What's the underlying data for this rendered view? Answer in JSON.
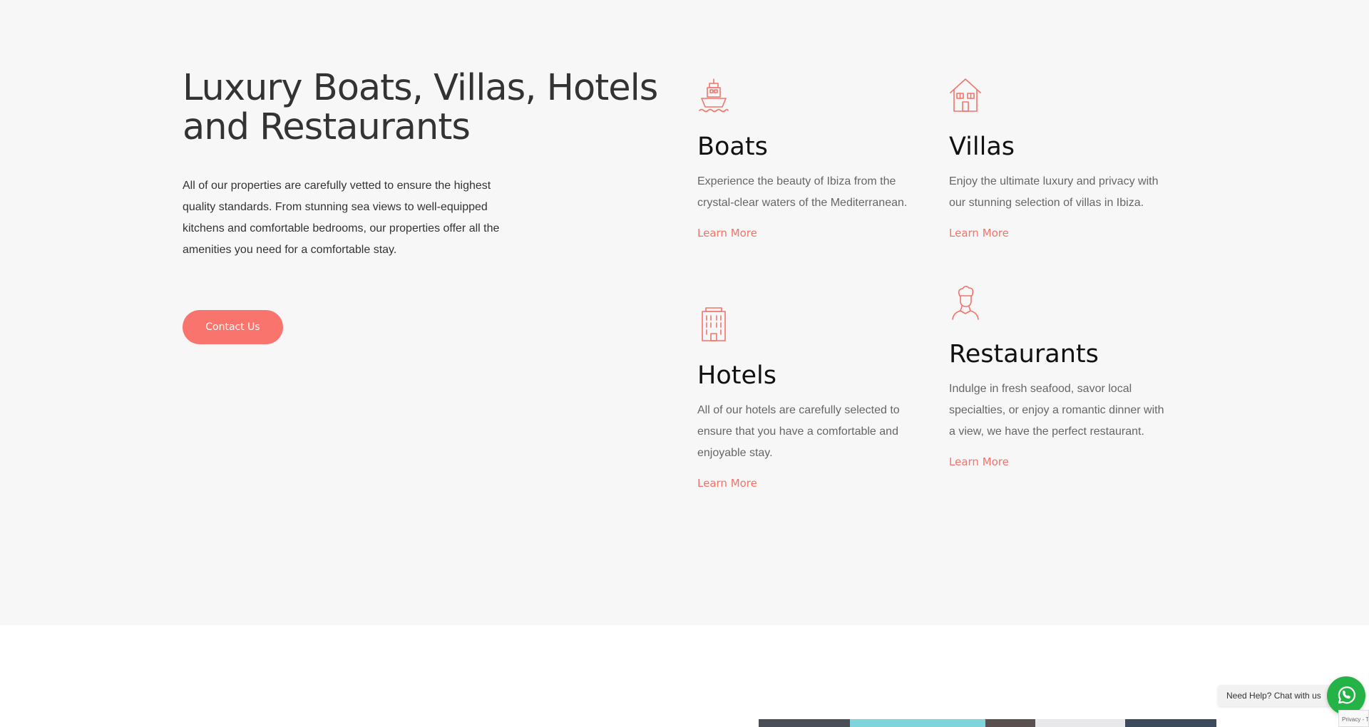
{
  "intro": {
    "title": "Luxury Boats, Villas, Hotels and Restaurants",
    "description": "All of our properties are carefully vetted to ensure the highest quality standards. From stunning sea views to well-equipped kitchens and comfortable bedrooms, our properties offer all the amenities you need for a comfortable stay.",
    "contact_label": "Contact Us"
  },
  "cards": [
    {
      "icon": "boat-icon",
      "title": "Boats",
      "text": "Experience the beauty of Ibiza from the crystal-clear waters of the Mediterranean.",
      "link": "Learn More"
    },
    {
      "icon": "house-icon",
      "title": "Villas",
      "text": "Enjoy the ultimate luxury and privacy with our stunning selection of villas in Ibiza.",
      "link": "Learn More"
    },
    {
      "icon": "hotel-building-icon",
      "title": "Hotels",
      "text": "All of our hotels are carefully selected to ensure that you have a comfortable and enjoyable stay.",
      "link": "Learn More"
    },
    {
      "icon": "chef-icon",
      "title": "Restaurants",
      "text": "Indulge in fresh seafood, savor local specialties, or enjoy a romantic dinner with a view, we have the perfect restaurant.",
      "link": "Learn More"
    }
  ],
  "chat": {
    "label": "Need Help? Chat with us",
    "icon": "whatsapp-icon"
  },
  "privacy": {
    "label": "Privacy - T"
  },
  "colors": {
    "accent": "#f8746d",
    "section_bg": "#f7f7f7",
    "whatsapp": "#25b246"
  }
}
